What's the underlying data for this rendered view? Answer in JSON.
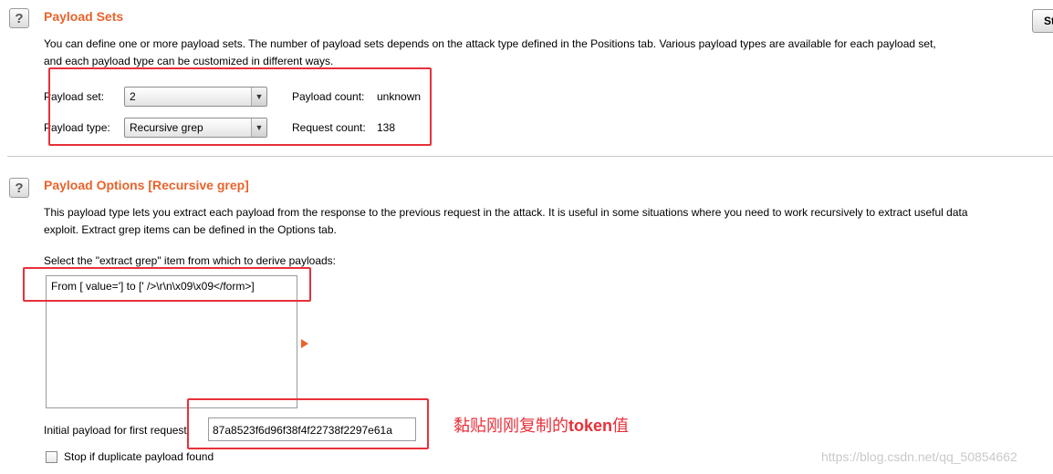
{
  "payload_sets": {
    "help_icon": "?",
    "title": "Payload Sets",
    "desc_line1": "You can define one or more payload sets. The number of payload sets depends on the attack type defined in the Positions tab. Various payload types are available for each payload set,",
    "desc_line2": "and each payload type can be customized in different ways.",
    "set_label": "Payload set:",
    "set_value": "2",
    "type_label": "Payload type:",
    "type_value": "Recursive grep",
    "count_label": "Payload count:",
    "count_value": "unknown",
    "request_label": "Request count:",
    "request_value": "138",
    "start_button": "St"
  },
  "payload_options": {
    "help_icon": "?",
    "title": "Payload Options [Recursive grep]",
    "desc_line1": "This payload type lets you extract each payload from the response to the previous request in the attack. It is useful in some situations where you need to work recursively to extract useful data",
    "desc_line2": "exploit. Extract grep items can be defined in the Options tab.",
    "select_label": "Select the \"extract grep\" item from which to derive payloads:",
    "grep_items": [
      "From [ value='] to [' />\\r\\n\\x09\\x09</form>]"
    ],
    "initial_label": "Initial payload for first request:",
    "initial_value": "87a8523f6d96f38f4f22738f2297e61a",
    "stop_label": "Stop if duplicate payload found"
  },
  "annotation": {
    "text_cn": "黏贴刚刚复制的",
    "text_token": "token",
    "text_cn2": "值"
  },
  "watermark": "https://blog.csdn.net/qq_50854662",
  "colors": {
    "heading": "#e8632b",
    "annotation": "#e8303a"
  }
}
